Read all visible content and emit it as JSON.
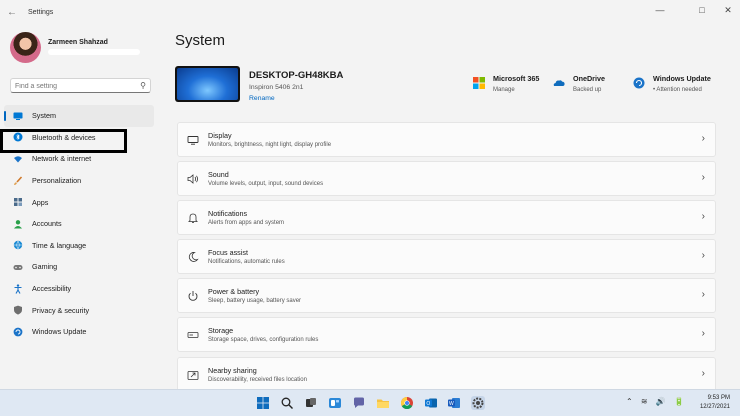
{
  "window": {
    "title": "Settings",
    "controls": {
      "minimize": "—",
      "maximize": "□",
      "close": "✕"
    }
  },
  "profile": {
    "name": "Zarmeen Shahzad"
  },
  "search": {
    "placeholder": "Find a setting"
  },
  "sidebar": {
    "items": [
      {
        "label": "System",
        "icon": "system-icon",
        "color": "#0078d4",
        "active": true
      },
      {
        "label": "Bluetooth & devices",
        "icon": "bluetooth-icon",
        "color": "#0078d4"
      },
      {
        "label": "Network & internet",
        "icon": "wifi-icon",
        "color": "#1a73c8"
      },
      {
        "label": "Personalization",
        "icon": "brush-icon",
        "color": "#d0792a"
      },
      {
        "label": "Apps",
        "icon": "apps-icon",
        "color": "#4a6a8a"
      },
      {
        "label": "Accounts",
        "icon": "accounts-icon",
        "color": "#2aa04a"
      },
      {
        "label": "Time & language",
        "icon": "globe-icon",
        "color": "#1a8ad4"
      },
      {
        "label": "Gaming",
        "icon": "gamepad-icon",
        "color": "#666666"
      },
      {
        "label": "Accessibility",
        "icon": "accessibility-icon",
        "color": "#1a73c8"
      },
      {
        "label": "Privacy & security",
        "icon": "shield-icon",
        "color": "#666666"
      },
      {
        "label": "Windows Update",
        "icon": "update-icon",
        "color": "#1a73c8"
      }
    ]
  },
  "main": {
    "title": "System",
    "device": {
      "name": "DESKTOP-GH48KBA",
      "model": "Inspiron 5406 2n1",
      "rename": "Rename"
    },
    "quick": [
      {
        "title": "Microsoft 365",
        "sub": "Manage",
        "icon": "microsoft-365-icon"
      },
      {
        "title": "OneDrive",
        "sub": "Backed up",
        "icon": "onedrive-icon"
      },
      {
        "title": "Windows Update",
        "sub": "• Attention needed",
        "icon": "windows-update-icon"
      }
    ],
    "cards": [
      {
        "title": "Display",
        "sub": "Monitors, brightness, night light, display profile",
        "icon": "display-icon"
      },
      {
        "title": "Sound",
        "sub": "Volume levels, output, input, sound devices",
        "icon": "sound-icon"
      },
      {
        "title": "Notifications",
        "sub": "Alerts from apps and system",
        "icon": "bell-icon"
      },
      {
        "title": "Focus assist",
        "sub": "Notifications, automatic rules",
        "icon": "moon-icon"
      },
      {
        "title": "Power & battery",
        "sub": "Sleep, battery usage, battery saver",
        "icon": "power-icon"
      },
      {
        "title": "Storage",
        "sub": "Storage space, drives, configuration rules",
        "icon": "storage-icon"
      },
      {
        "title": "Nearby sharing",
        "sub": "Discoverability, received files location",
        "icon": "share-icon"
      }
    ]
  },
  "taskbar": {
    "time": "9:53 PM",
    "date": "12/27/2021",
    "tray": "⌃ ≋ 🔊 🔋"
  }
}
